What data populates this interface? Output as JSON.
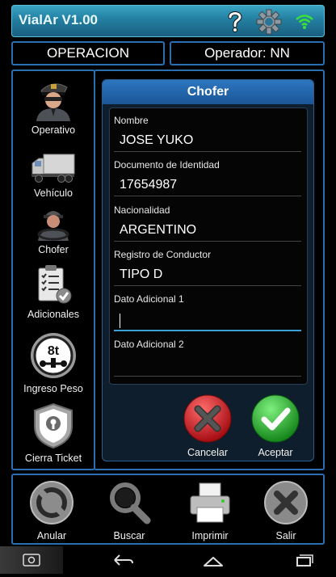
{
  "app": {
    "title": "VialAr V1.00"
  },
  "header": {
    "operation": "OPERACION",
    "operator": "Operador:  NN"
  },
  "menu": [
    {
      "label": "Operativo",
      "icon": "police-officer-icon"
    },
    {
      "label": "Vehículo",
      "icon": "truck-icon"
    },
    {
      "label": "Chofer",
      "icon": "driver-icon"
    },
    {
      "label": "Adicionales",
      "icon": "checklist-icon"
    },
    {
      "label": "Ingreso Peso",
      "icon": "weight-8t-icon",
      "badge": "8t"
    },
    {
      "label": "Cierra Ticket",
      "icon": "keyhole-shield-icon"
    }
  ],
  "form": {
    "title": "Chofer",
    "fields": [
      {
        "label": "Nombre",
        "value": "JOSE YUKO"
      },
      {
        "label": "Documento de Identidad",
        "value": "17654987"
      },
      {
        "label": "Nacionalidad",
        "value": "ARGENTINO"
      },
      {
        "label": "Registro de Conductor",
        "value": "TIPO D"
      },
      {
        "label": "Dato Adicional 1",
        "value": ""
      },
      {
        "label": "Dato Adicional 2",
        "value": ""
      }
    ],
    "cancel_label": "Cancelar",
    "accept_label": "Aceptar"
  },
  "bottom": [
    {
      "label": "Anular",
      "icon": "prohibited-icon"
    },
    {
      "label": "Buscar",
      "icon": "magnifier-icon"
    },
    {
      "label": "Imprimir",
      "icon": "printer-icon"
    },
    {
      "label": "Salir",
      "icon": "exit-x-icon"
    }
  ],
  "colors": {
    "accent": "#2a6fb0",
    "cancel": "#d8222a",
    "accept": "#2ea82e",
    "title_bar": "#237fa0"
  }
}
